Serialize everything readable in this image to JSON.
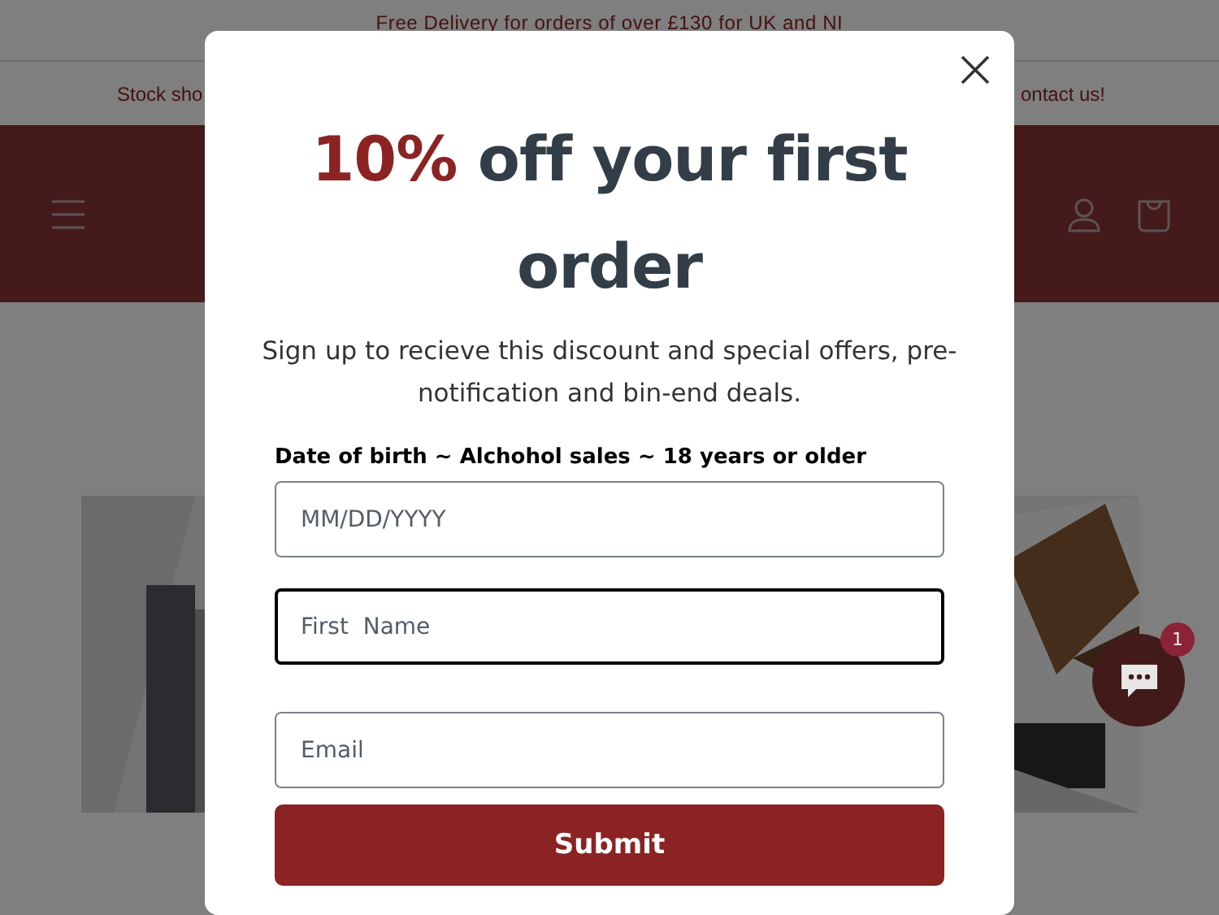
{
  "announcement_bar": {
    "text": "Free Delivery for orders of over £130 for UK and NI"
  },
  "stock_bar": {
    "left_text": "Stock sho",
    "right_text": "ontact us!"
  },
  "chat_widget": {
    "badge": "1"
  },
  "popup": {
    "heading": {
      "highlight": "10%",
      "rest": "off your first order"
    },
    "subtitle": "Sign up to recieve this discount and special offers, pre-notification and bin-end deals.",
    "dob_label": "Date of birth ~ Alchohol sales ~ 18 years or older",
    "fields": [
      {
        "placeholder": "MM/DD/YYYY",
        "focused": false
      },
      {
        "placeholder": "First  Name",
        "focused": true
      },
      {
        "placeholder": "Email",
        "focused": false
      }
    ],
    "submit": "Submit"
  }
}
